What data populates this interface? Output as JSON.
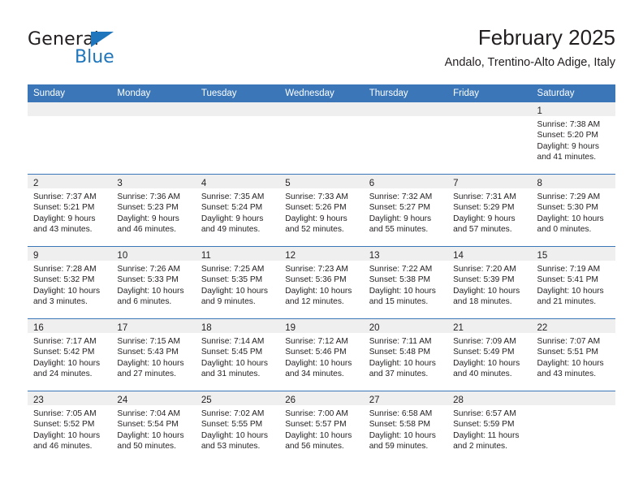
{
  "brand": {
    "name_top": "General",
    "name_bottom": "Blue",
    "accent_color": "#1f76bd"
  },
  "header": {
    "title": "February 2025",
    "subtitle": "Andalo, Trentino-Alto Adige, Italy"
  },
  "calendar": {
    "header_bg": "#3a76b8",
    "daynum_band_bg": "#efefef",
    "weekday_labels": [
      "Sunday",
      "Monday",
      "Tuesday",
      "Wednesday",
      "Thursday",
      "Friday",
      "Saturday"
    ],
    "weeks": [
      [
        {
          "day": "",
          "lines": []
        },
        {
          "day": "",
          "lines": []
        },
        {
          "day": "",
          "lines": []
        },
        {
          "day": "",
          "lines": []
        },
        {
          "day": "",
          "lines": []
        },
        {
          "day": "",
          "lines": []
        },
        {
          "day": "1",
          "lines": [
            "Sunrise: 7:38 AM",
            "Sunset: 5:20 PM",
            "Daylight: 9 hours",
            "and 41 minutes."
          ]
        }
      ],
      [
        {
          "day": "2",
          "lines": [
            "Sunrise: 7:37 AM",
            "Sunset: 5:21 PM",
            "Daylight: 9 hours",
            "and 43 minutes."
          ]
        },
        {
          "day": "3",
          "lines": [
            "Sunrise: 7:36 AM",
            "Sunset: 5:23 PM",
            "Daylight: 9 hours",
            "and 46 minutes."
          ]
        },
        {
          "day": "4",
          "lines": [
            "Sunrise: 7:35 AM",
            "Sunset: 5:24 PM",
            "Daylight: 9 hours",
            "and 49 minutes."
          ]
        },
        {
          "day": "5",
          "lines": [
            "Sunrise: 7:33 AM",
            "Sunset: 5:26 PM",
            "Daylight: 9 hours",
            "and 52 minutes."
          ]
        },
        {
          "day": "6",
          "lines": [
            "Sunrise: 7:32 AM",
            "Sunset: 5:27 PM",
            "Daylight: 9 hours",
            "and 55 minutes."
          ]
        },
        {
          "day": "7",
          "lines": [
            "Sunrise: 7:31 AM",
            "Sunset: 5:29 PM",
            "Daylight: 9 hours",
            "and 57 minutes."
          ]
        },
        {
          "day": "8",
          "lines": [
            "Sunrise: 7:29 AM",
            "Sunset: 5:30 PM",
            "Daylight: 10 hours",
            "and 0 minutes."
          ]
        }
      ],
      [
        {
          "day": "9",
          "lines": [
            "Sunrise: 7:28 AM",
            "Sunset: 5:32 PM",
            "Daylight: 10 hours",
            "and 3 minutes."
          ]
        },
        {
          "day": "10",
          "lines": [
            "Sunrise: 7:26 AM",
            "Sunset: 5:33 PM",
            "Daylight: 10 hours",
            "and 6 minutes."
          ]
        },
        {
          "day": "11",
          "lines": [
            "Sunrise: 7:25 AM",
            "Sunset: 5:35 PM",
            "Daylight: 10 hours",
            "and 9 minutes."
          ]
        },
        {
          "day": "12",
          "lines": [
            "Sunrise: 7:23 AM",
            "Sunset: 5:36 PM",
            "Daylight: 10 hours",
            "and 12 minutes."
          ]
        },
        {
          "day": "13",
          "lines": [
            "Sunrise: 7:22 AM",
            "Sunset: 5:38 PM",
            "Daylight: 10 hours",
            "and 15 minutes."
          ]
        },
        {
          "day": "14",
          "lines": [
            "Sunrise: 7:20 AM",
            "Sunset: 5:39 PM",
            "Daylight: 10 hours",
            "and 18 minutes."
          ]
        },
        {
          "day": "15",
          "lines": [
            "Sunrise: 7:19 AM",
            "Sunset: 5:41 PM",
            "Daylight: 10 hours",
            "and 21 minutes."
          ]
        }
      ],
      [
        {
          "day": "16",
          "lines": [
            "Sunrise: 7:17 AM",
            "Sunset: 5:42 PM",
            "Daylight: 10 hours",
            "and 24 minutes."
          ]
        },
        {
          "day": "17",
          "lines": [
            "Sunrise: 7:15 AM",
            "Sunset: 5:43 PM",
            "Daylight: 10 hours",
            "and 27 minutes."
          ]
        },
        {
          "day": "18",
          "lines": [
            "Sunrise: 7:14 AM",
            "Sunset: 5:45 PM",
            "Daylight: 10 hours",
            "and 31 minutes."
          ]
        },
        {
          "day": "19",
          "lines": [
            "Sunrise: 7:12 AM",
            "Sunset: 5:46 PM",
            "Daylight: 10 hours",
            "and 34 minutes."
          ]
        },
        {
          "day": "20",
          "lines": [
            "Sunrise: 7:11 AM",
            "Sunset: 5:48 PM",
            "Daylight: 10 hours",
            "and 37 minutes."
          ]
        },
        {
          "day": "21",
          "lines": [
            "Sunrise: 7:09 AM",
            "Sunset: 5:49 PM",
            "Daylight: 10 hours",
            "and 40 minutes."
          ]
        },
        {
          "day": "22",
          "lines": [
            "Sunrise: 7:07 AM",
            "Sunset: 5:51 PM",
            "Daylight: 10 hours",
            "and 43 minutes."
          ]
        }
      ],
      [
        {
          "day": "23",
          "lines": [
            "Sunrise: 7:05 AM",
            "Sunset: 5:52 PM",
            "Daylight: 10 hours",
            "and 46 minutes."
          ]
        },
        {
          "day": "24",
          "lines": [
            "Sunrise: 7:04 AM",
            "Sunset: 5:54 PM",
            "Daylight: 10 hours",
            "and 50 minutes."
          ]
        },
        {
          "day": "25",
          "lines": [
            "Sunrise: 7:02 AM",
            "Sunset: 5:55 PM",
            "Daylight: 10 hours",
            "and 53 minutes."
          ]
        },
        {
          "day": "26",
          "lines": [
            "Sunrise: 7:00 AM",
            "Sunset: 5:57 PM",
            "Daylight: 10 hours",
            "and 56 minutes."
          ]
        },
        {
          "day": "27",
          "lines": [
            "Sunrise: 6:58 AM",
            "Sunset: 5:58 PM",
            "Daylight: 10 hours",
            "and 59 minutes."
          ]
        },
        {
          "day": "28",
          "lines": [
            "Sunrise: 6:57 AM",
            "Sunset: 5:59 PM",
            "Daylight: 11 hours",
            "and 2 minutes."
          ]
        },
        {
          "day": "",
          "lines": []
        }
      ]
    ]
  }
}
